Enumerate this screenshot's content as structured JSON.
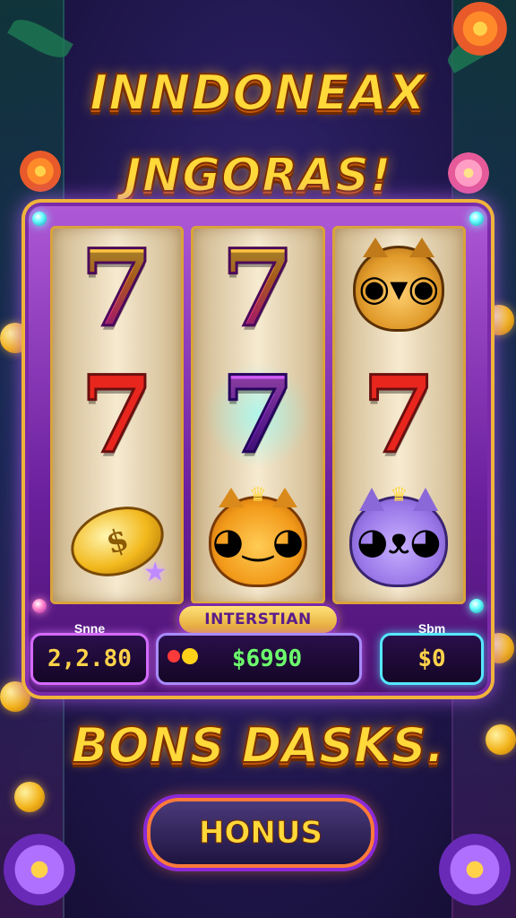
{
  "title": {
    "line1": "INNDONEAX",
    "line2": "JNGORAS!"
  },
  "reels": [
    [
      "7",
      "7",
      "coin"
    ],
    [
      "7",
      "7",
      "lion"
    ],
    [
      "tiger",
      "7",
      "cat"
    ]
  ],
  "coin_symbol": "$",
  "banner": "INTERSTIAN",
  "panels": {
    "left": {
      "label": "Snne",
      "value": "2,2.80"
    },
    "mid": {
      "value": "$6990"
    },
    "right": {
      "label": "Sbm",
      "value": "$0"
    }
  },
  "bonus_title": "BONS DASKS.",
  "bonus_button": "HONUS",
  "colors": {
    "gold": "#ffd83a",
    "purple": "#7a2aa8",
    "green_value": "#6cff6c",
    "cyan": "#55e8ff"
  }
}
